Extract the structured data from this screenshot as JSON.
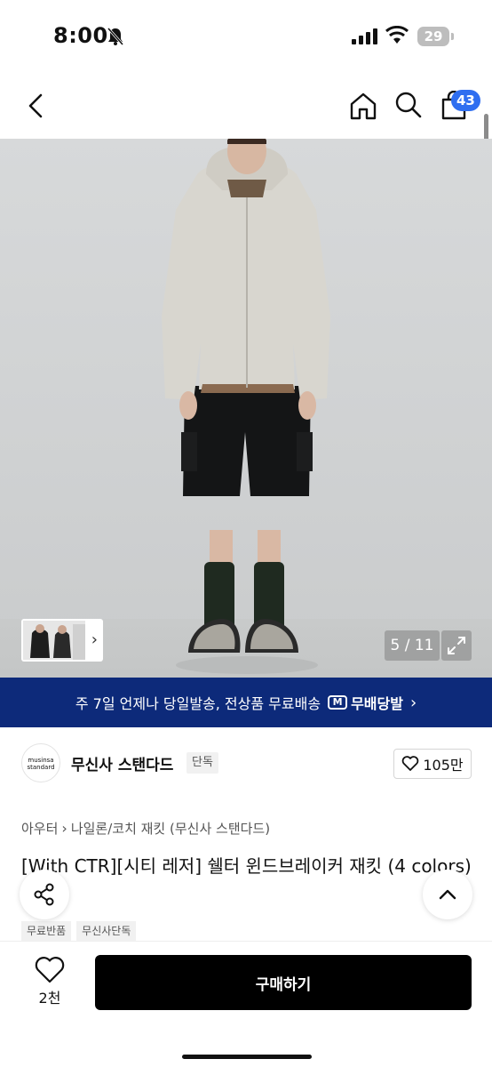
{
  "status_bar": {
    "time": "8:00",
    "battery": "29"
  },
  "nav": {
    "cart_count": "43"
  },
  "gallery": {
    "counter": "5 / 11"
  },
  "promo": {
    "text": "주 7일 언제나 당일발송, 전상품 무료배송",
    "badge": "무배당발",
    "badge_icon_letter": "M"
  },
  "brand": {
    "logo_line1": "musinsa",
    "logo_line2": "standard",
    "name": "무신사 스탠다드",
    "exclusive": "단독",
    "likes": "105만"
  },
  "breadcrumb": {
    "category": "아우터",
    "subcategory": "나일론/코치 재킷 (무신사 스탠다드)"
  },
  "product": {
    "title": "[With CTR][시티 레저] 쉘터 윈드브레이커 재킷 (4 colors)",
    "tags": [
      "무료반품",
      "무신사단독"
    ]
  },
  "bottom_bar": {
    "like_count": "2천",
    "buy_label": "구매하기"
  },
  "colors": {
    "promo_bg": "#0d2a7a",
    "cart_badge": "#2f6ef0",
    "buy_button": "#000000"
  }
}
